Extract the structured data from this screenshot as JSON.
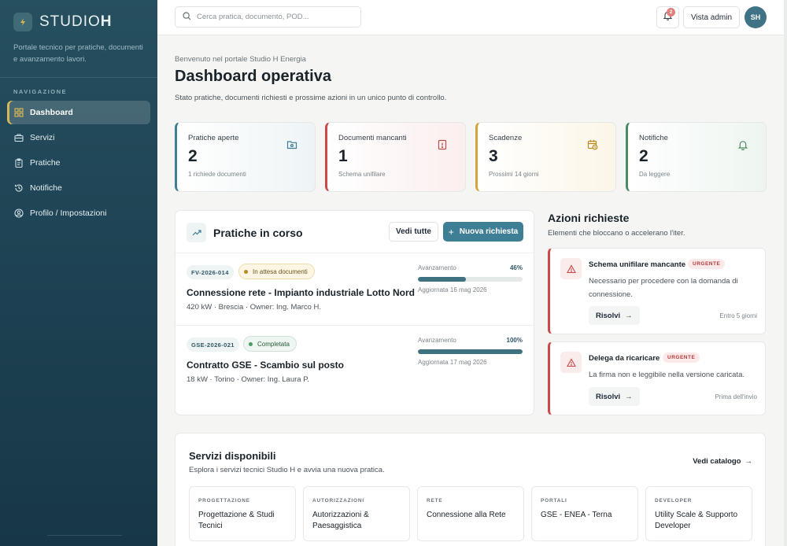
{
  "brand": {
    "name_light": "STUDIO",
    "name_bold": "H",
    "tagline": "Portale tecnico per pratiche, documenti e avanzamento lavori."
  },
  "nav": {
    "section_label": "NAVIGAZIONE",
    "items": [
      {
        "label": "Dashboard",
        "icon": "grid-icon",
        "active": true
      },
      {
        "label": "Servizi",
        "icon": "briefcase-icon",
        "active": false
      },
      {
        "label": "Pratiche",
        "icon": "clipboard-icon",
        "active": false
      },
      {
        "label": "Notifiche",
        "icon": "history-icon",
        "active": false
      },
      {
        "label": "Profilo / Impostazioni",
        "icon": "user-circle-icon",
        "active": false
      }
    ]
  },
  "topbar": {
    "search_placeholder": "Cerca pratica, documento, POD...",
    "notifications_count": "2",
    "admin_label": "Vista admin",
    "avatar_initials": "SH"
  },
  "header": {
    "welcome": "Benvenuto nel portale Studio H Energia",
    "title": "Dashboard operativa",
    "subtitle": "Stato pratiche, documenti richiesti e prossime azioni in un unico punto di controllo."
  },
  "stats": [
    {
      "label": "Pratiche aperte",
      "value": "2",
      "sub": "1 richiede documenti",
      "color": "#3f7f95",
      "bg": "#eef4f6",
      "icon": "folder-icon"
    },
    {
      "label": "Documenti mancanti",
      "value": "1",
      "sub": "Schema unifilare",
      "color": "#c9494a",
      "bg": "#fbeeee",
      "icon": "file-alert-icon"
    },
    {
      "label": "Scadenze",
      "value": "3",
      "sub": "Prossimi 14 giorni",
      "color": "#d4a43a",
      "bg": "#fcf6e8",
      "icon": "calendar-clock-icon"
    },
    {
      "label": "Notifiche",
      "value": "2",
      "sub": "Da leggere",
      "color": "#4c8a62",
      "bg": "#eef5f0",
      "icon": "bell-icon"
    }
  ],
  "pratiche": {
    "title": "Pratiche in corso",
    "view_all": "Vedi tutte",
    "new_request": "Nuova richiesta",
    "progress_label": "Avanzamento",
    "rows": [
      {
        "code": "FV-2026-014",
        "status": "In attesa documenti",
        "status_kind": "wait",
        "title": "Connessione rete - Impianto industriale Lotto Nord",
        "meta": "420 kW · Brescia · Owner: Ing. Marco H.",
        "progress": 46,
        "progress_text": "46%",
        "updated": "Aggiornata 16 mag 2026"
      },
      {
        "code": "GSE-2026-021",
        "status": "Completata",
        "status_kind": "done",
        "title": "Contratto GSE - Scambio sul posto",
        "meta": "18 kW · Torino · Owner: Ing. Laura P.",
        "progress": 100,
        "progress_text": "100%",
        "updated": "Aggiornata 17 mag 2026"
      }
    ]
  },
  "azioni": {
    "title": "Azioni richieste",
    "subtitle": "Elementi che bloccano o accelerano l'iter.",
    "urgent_label": "URGENTE",
    "resolve_label": "Risolvi",
    "items": [
      {
        "title": "Schema unifilare mancante",
        "desc": "Necessario per procedere con la domanda di connessione.",
        "due": "Entro 5 giorni"
      },
      {
        "title": "Delega da ricaricare",
        "desc": "La firma non e leggibile nella versione caricata.",
        "due": "Prima dell'invio"
      }
    ]
  },
  "servizi": {
    "title": "Servizi disponibili",
    "subtitle": "Esplora i servizi tecnici Studio H e avvia una nuova pratica.",
    "catalog_link": "Vedi catalogo",
    "items": [
      {
        "category": "PROGETTAZIONE",
        "name": "Progettazione & Studi Tecnici"
      },
      {
        "category": "AUTORIZZAZIONI",
        "name": "Autorizzazioni & Paesaggistica"
      },
      {
        "category": "RETE",
        "name": "Connessione alla Rete"
      },
      {
        "category": "PORTALI",
        "name": "GSE - ENEA - Terna"
      },
      {
        "category": "DEVELOPER",
        "name": "Utility Scale & Supporto Developer"
      }
    ]
  }
}
